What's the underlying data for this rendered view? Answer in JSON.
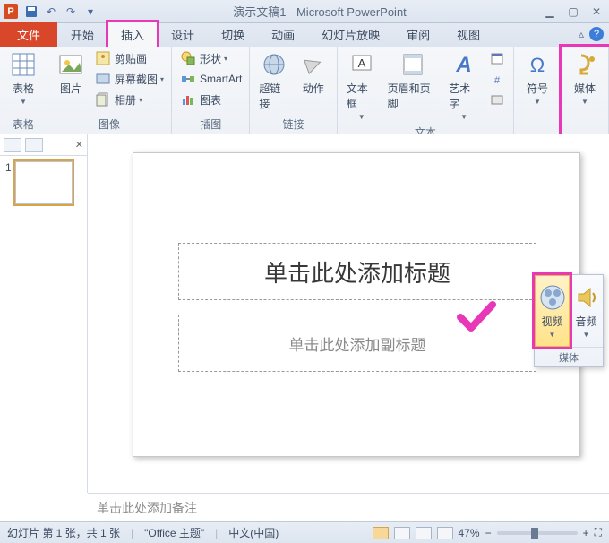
{
  "title": "演示文稿1 - Microsoft PowerPoint",
  "tabs": {
    "file": "文件",
    "home": "开始",
    "insert": "插入",
    "design": "设计",
    "transitions": "切换",
    "animations": "动画",
    "slideshow": "幻灯片放映",
    "review": "审阅",
    "view": "视图"
  },
  "ribbon": {
    "groups": {
      "tables": {
        "label": "表格",
        "table_btn": "表格"
      },
      "images": {
        "label": "图像",
        "picture_btn": "图片",
        "clipart": "剪贴画",
        "screenshot": "屏幕截图",
        "album": "相册"
      },
      "illustrations": {
        "label": "插图",
        "shapes": "形状",
        "smartart": "SmartArt",
        "chart": "图表"
      },
      "links": {
        "label": "链接",
        "hyperlink": "超链接",
        "action": "动作"
      },
      "text": {
        "label": "文本",
        "textbox": "文本框",
        "headerfooter": "页眉和页脚",
        "wordart": "艺术字"
      },
      "symbols": {
        "label": "",
        "symbol": "符号"
      },
      "media": {
        "label": "媒体",
        "media_btn": "媒体"
      }
    }
  },
  "popup": {
    "video": "视频",
    "audio": "音频",
    "group": "媒体"
  },
  "slide": {
    "title_placeholder": "单击此处添加标题",
    "subtitle_placeholder": "单击此处添加副标题"
  },
  "notes": {
    "placeholder": "单击此处添加备注"
  },
  "status": {
    "slide_info": "幻灯片 第 1 张，共 1 张",
    "theme": "\"Office 主题\"",
    "lang": "中文(中国)",
    "zoom": "47%"
  }
}
